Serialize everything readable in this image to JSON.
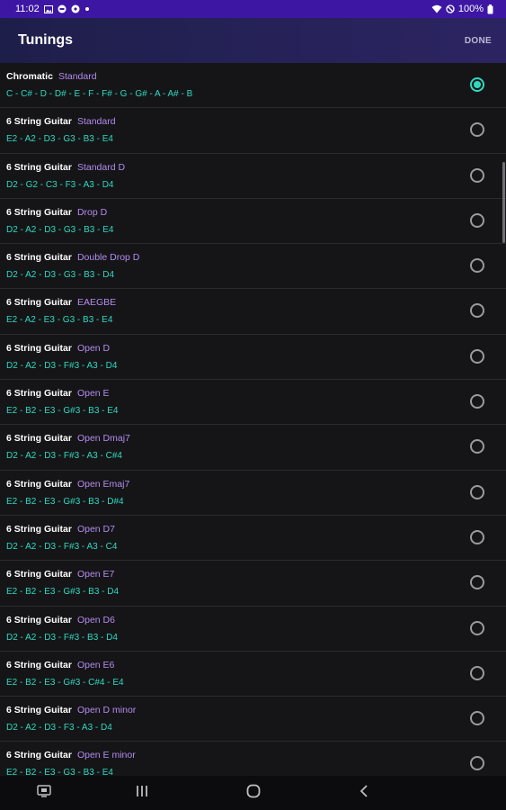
{
  "status_bar": {
    "time": "11:02",
    "battery": "100%",
    "icons": [
      "gallery-icon",
      "notification-icon",
      "app-icon",
      "dot-icon",
      "wifi-icon",
      "no-sound-icon",
      "battery-icon"
    ]
  },
  "app_bar": {
    "title": "Tunings",
    "done_label": "DONE"
  },
  "colors": {
    "status_bar": "#3d17a3",
    "instrument_text": "#ffffff",
    "tuning_name": "#b48cf0",
    "notes_text": "#2fd9c0",
    "radio_selected": "#2fd9c0"
  },
  "tunings": [
    {
      "instrument": "Chromatic",
      "name": "Standard",
      "notes": "C - C# - D - D# - E - F - F# - G - G# - A - A# - B",
      "selected": true
    },
    {
      "instrument": "6 String Guitar",
      "name": "Standard",
      "notes": "E2 - A2 - D3 - G3 - B3 - E4",
      "selected": false
    },
    {
      "instrument": "6 String Guitar",
      "name": "Standard D",
      "notes": "D2 - G2 - C3 - F3 - A3 - D4",
      "selected": false
    },
    {
      "instrument": "6 String Guitar",
      "name": "Drop D",
      "notes": "D2 - A2 - D3 - G3 - B3 - E4",
      "selected": false
    },
    {
      "instrument": "6 String Guitar",
      "name": "Double Drop D",
      "notes": "D2 - A2 - D3 - G3 - B3 - D4",
      "selected": false
    },
    {
      "instrument": "6 String Guitar",
      "name": "EAEGBE",
      "notes": "E2 - A2 - E3 - G3 - B3 - E4",
      "selected": false
    },
    {
      "instrument": "6 String Guitar",
      "name": "Open D",
      "notes": "D2 - A2 - D3 - F#3 - A3 - D4",
      "selected": false
    },
    {
      "instrument": "6 String Guitar",
      "name": "Open E",
      "notes": "E2 - B2 - E3 - G#3 - B3 - E4",
      "selected": false
    },
    {
      "instrument": "6 String Guitar",
      "name": "Open Dmaj7",
      "notes": "D2 - A2 - D3 - F#3 - A3 - C#4",
      "selected": false
    },
    {
      "instrument": "6 String Guitar",
      "name": "Open Emaj7",
      "notes": "E2 - B2 - E3 - G#3 - B3 - D#4",
      "selected": false
    },
    {
      "instrument": "6 String Guitar",
      "name": "Open D7",
      "notes": "D2 - A2 - D3 - F#3 - A3 - C4",
      "selected": false
    },
    {
      "instrument": "6 String Guitar",
      "name": "Open E7",
      "notes": "E2 - B2 - E3 - G#3 - B3 - D4",
      "selected": false
    },
    {
      "instrument": "6 String Guitar",
      "name": "Open D6",
      "notes": "D2 - A2 - D3 - F#3 - B3 - D4",
      "selected": false
    },
    {
      "instrument": "6 String Guitar",
      "name": "Open E6",
      "notes": "E2 - B2 - E3 - G#3 - C#4 - E4",
      "selected": false
    },
    {
      "instrument": "6 String Guitar",
      "name": "Open D minor",
      "notes": "D2 - A2 - D3 - F3 - A3 - D4",
      "selected": false
    },
    {
      "instrument": "6 String Guitar",
      "name": "Open E minor",
      "notes": "E2 - B2 - E3 - G3 - B3 - E4",
      "selected": false
    }
  ],
  "nav_bar": {
    "buttons": [
      "recent-screenshot-icon",
      "recents-icon",
      "home-icon",
      "back-icon"
    ]
  }
}
